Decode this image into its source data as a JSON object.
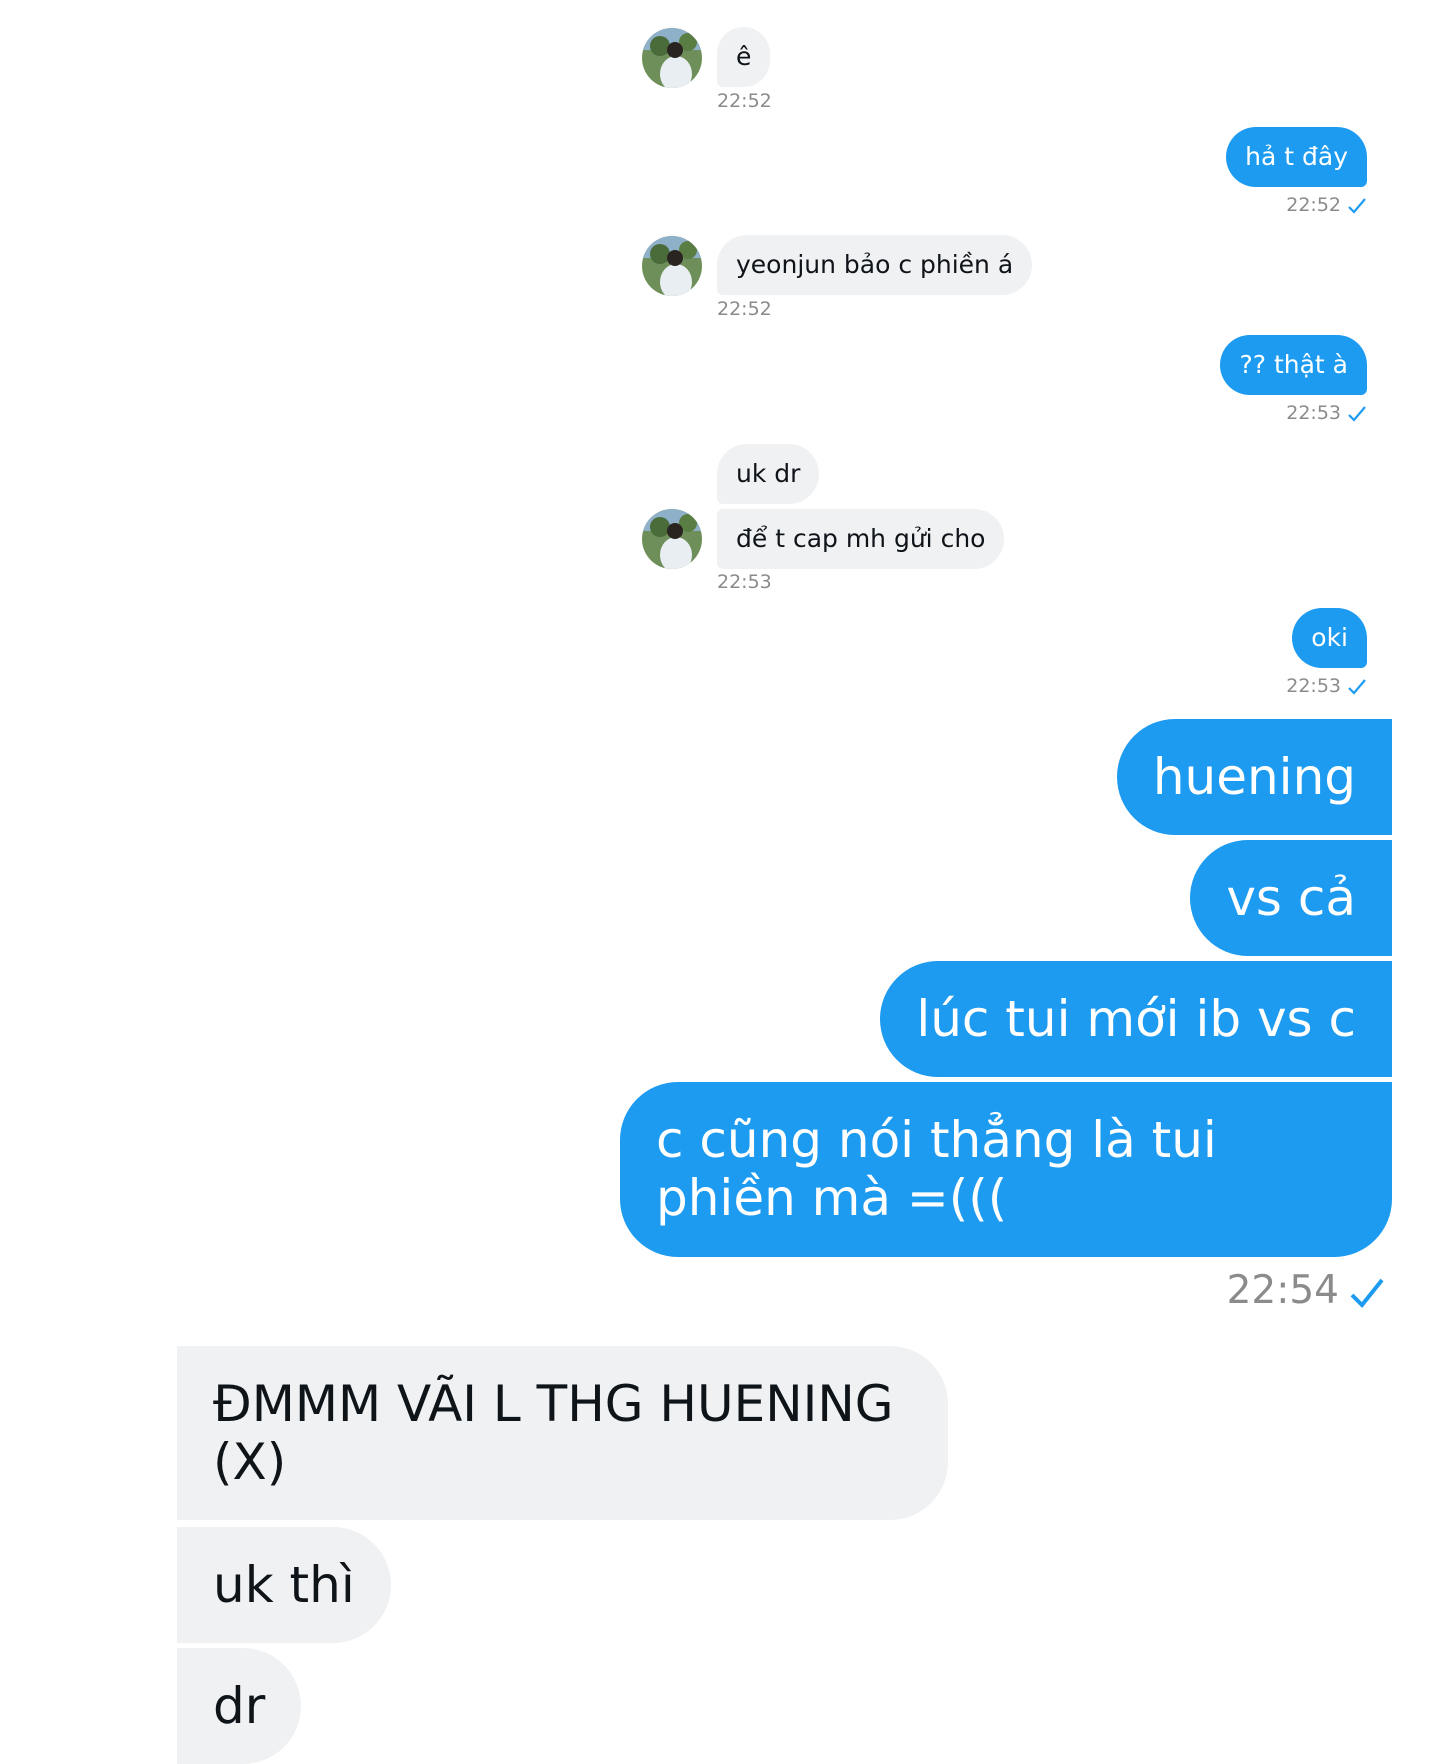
{
  "colors": {
    "accent": "#1d9bf0",
    "incoming_bg": "#eff1f3",
    "timestamp": "#8b8b8b"
  },
  "messages": [
    {
      "dir": "in",
      "text": "ê"
    },
    {
      "dir": "out",
      "text": "hả t đây"
    },
    {
      "dir": "in",
      "text": "yeonjun bảo c phiền á"
    },
    {
      "dir": "out",
      "text": "?? thật à"
    },
    {
      "dir": "in",
      "text": "uk dr"
    },
    {
      "dir": "in",
      "text": "để t cap mh gửi cho"
    },
    {
      "dir": "out",
      "text": "oki"
    },
    {
      "dir": "out",
      "text": "huening"
    },
    {
      "dir": "out",
      "text": "vs cả"
    },
    {
      "dir": "out",
      "text": "lúc tui mới ib vs c"
    },
    {
      "dir": "out",
      "text": "c cũng nói thẳng là tui phiền mà =((("
    },
    {
      "dir": "in",
      "text": "ĐMMM VÃI L THG HUENING (X)"
    },
    {
      "dir": "in",
      "text": "uk thì"
    },
    {
      "dir": "in",
      "text": "dr"
    }
  ],
  "timestamps": [
    "22:52",
    "22:52",
    "22:52",
    "22:53",
    "22:53",
    "22:53",
    "22:54"
  ],
  "icons": {
    "avatar": "user-avatar-photo",
    "read": "checkmark-icon"
  }
}
